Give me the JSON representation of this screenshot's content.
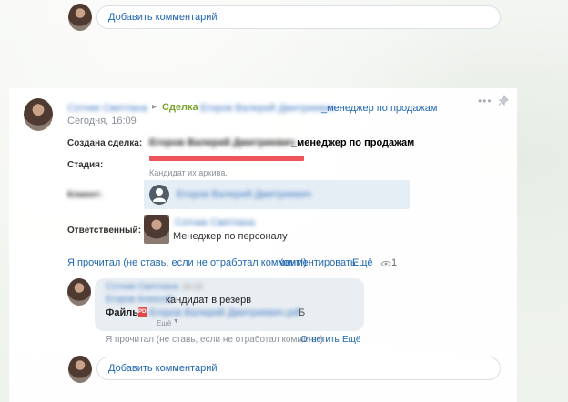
{
  "top_comment": {
    "add_comment_label": "Добавить комментарий"
  },
  "post": {
    "author": "Сотник Светлана",
    "entity_type": "Сделка",
    "entity_name_blurred": "Егоров Валерий Дмитриевич",
    "entity_name_suffix": "_менеджер по продажам",
    "time": "Сегодня, 16:09",
    "more_icon": "ellipsis-icon",
    "pin_icon": "pin-icon"
  },
  "details": {
    "created_label": "Создана сделка:",
    "created_name_blurred": "Егоров Валерий Дмитриевич",
    "created_name_suffix": "_менеджер по продажам",
    "stage_label": "Стадия:",
    "stage_color": "#f0545b",
    "stage_text": "Кандидат их архива.",
    "client_label": "Клиент:",
    "client_name": "Егоров Валерий Дмитриевич",
    "responsible_label": "Ответственный:",
    "responsible_name": "Сотник Светлана",
    "responsible_role": "Менеджер по персоналу"
  },
  "actions": {
    "read_label": "Я прочитал (не ставь, если не отработал коммент!)",
    "comment_label": "Комментировать",
    "more_label": "Ещё",
    "views_count": "1"
  },
  "reply": {
    "author": "Сотник Светлана",
    "time": "16:13",
    "mention": "Егоров Алексей",
    "text": "кандидат в резерв",
    "files_label": "Файлы:",
    "file_name": "Егоров Валерий Дмитриевич.pdf",
    "file_size_unit": "Б",
    "file_more": "Ещё"
  },
  "reply_actions": {
    "read_label": "Я прочитал (не ставь, если не отработал коммент!)",
    "reply_label": "Ответить",
    "more_label": "Ещё"
  },
  "bottom_comment": {
    "add_comment_label": "Добавить комментарий"
  }
}
